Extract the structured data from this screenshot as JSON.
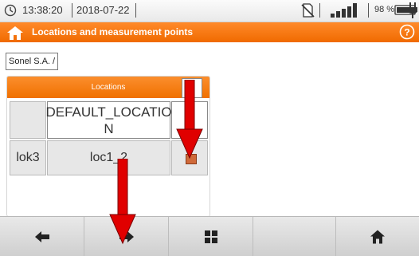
{
  "status_bar": {
    "time": "13:38:20",
    "date": "2018-07-22",
    "battery_percent": "98 %"
  },
  "title_bar": {
    "title": "Locations and measurement points"
  },
  "breadcrumb": {
    "path": "Sonel S.A. /"
  },
  "locations_panel": {
    "header": "Locations",
    "rows": [
      {
        "code": "",
        "name": "DEFAULT_LOCATIO\nN",
        "checked": false
      },
      {
        "code": "lok3",
        "name": "loc1_2",
        "checked": true
      }
    ]
  },
  "toolbar": {
    "buttons": [
      "arrow-left-icon",
      "arrow-right-icon",
      "grid-icon",
      "empty",
      "home-icon"
    ]
  },
  "colors": {
    "accent": "#f07000",
    "annotation_arrow": "#e00000"
  }
}
